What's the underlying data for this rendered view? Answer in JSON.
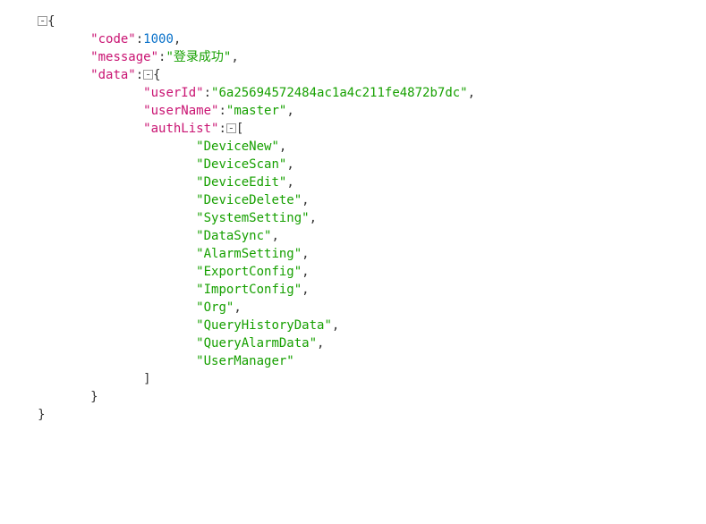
{
  "toggle_glyph": "-",
  "root": {
    "k_code": "\"code\"",
    "v_code": "1000",
    "k_message": "\"message\"",
    "v_message": "\"登录成功\"",
    "k_data": "\"data\"",
    "data": {
      "k_userId": "\"userId\"",
      "v_userId": "\"6a25694572484ac1a4c211fe4872b7dc\"",
      "k_userName": "\"userName\"",
      "v_userName": "\"master\"",
      "k_authList": "\"authList\"",
      "authList": [
        "\"DeviceNew\"",
        "\"DeviceScan\"",
        "\"DeviceEdit\"",
        "\"DeviceDelete\"",
        "\"SystemSetting\"",
        "\"DataSync\"",
        "\"AlarmSetting\"",
        "\"ExportConfig\"",
        "\"ImportConfig\"",
        "\"Org\"",
        "\"QueryHistoryData\"",
        "\"QueryAlarmData\"",
        "\"UserManager\""
      ]
    }
  }
}
